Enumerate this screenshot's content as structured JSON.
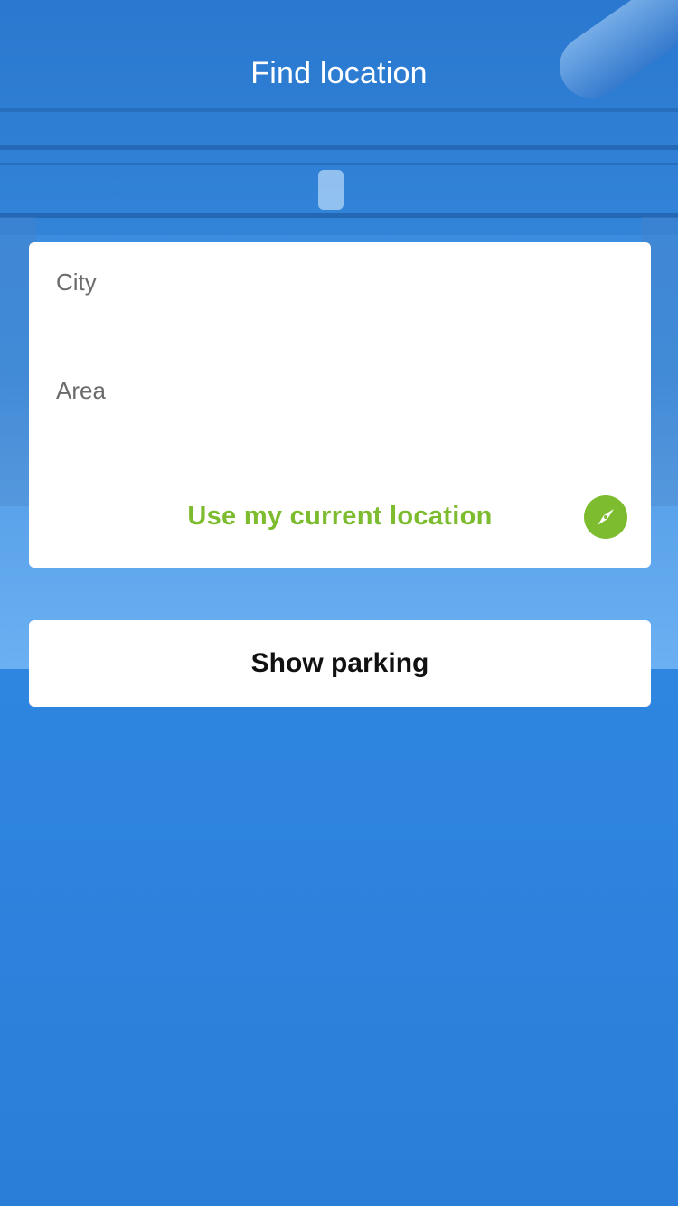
{
  "header": {
    "title": "Find location"
  },
  "form": {
    "city_placeholder": "City",
    "area_placeholder": "Area",
    "current_location_label": "Use my current location",
    "current_location_icon": "compass-icon"
  },
  "actions": {
    "show_parking_label": "Show parking"
  },
  "colors": {
    "accent_green": "#7cbc2e",
    "background_blue": "#3a95ec",
    "card": "#ffffff"
  }
}
